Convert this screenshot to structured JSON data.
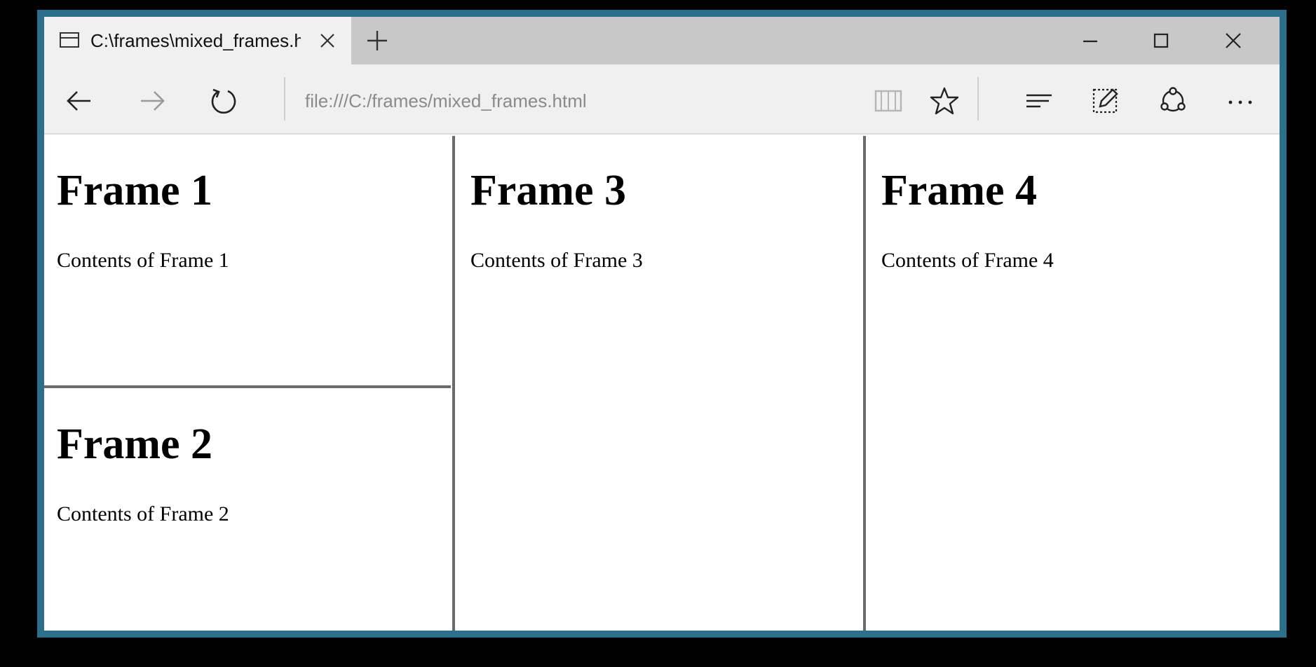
{
  "tab": {
    "title": "C:\\frames\\mixed_frames.html"
  },
  "address_bar": {
    "url": "file:///C:/frames/mixed_frames.html"
  },
  "frames": [
    {
      "heading": "Frame 1",
      "text": "Contents of Frame 1"
    },
    {
      "heading": "Frame 2",
      "text": "Contents of Frame 2"
    },
    {
      "heading": "Frame 3",
      "text": "Contents of Frame 3"
    },
    {
      "heading": "Frame 4",
      "text": "Contents of Frame 4"
    }
  ],
  "icons": {
    "tab": "tab-page-icon",
    "tab_close": "close-icon",
    "new_tab": "plus-icon",
    "minimize": "minimize-icon",
    "maximize": "maximize-icon",
    "close": "close-icon",
    "back": "arrow-left-icon",
    "forward": "arrow-right-icon",
    "refresh": "refresh-icon",
    "reading_view": "book-icon",
    "favorite": "star-icon",
    "hub": "hub-icon",
    "web_note": "pen-note-icon",
    "share": "share-icon",
    "more": "more-icon"
  },
  "colors": {
    "window_border": "#2a6f8b",
    "tabstrip": "#c8c8c8",
    "toolbar": "#f0f0f0",
    "address_text": "#8a8a8a",
    "frame_divider": "#6b6b6b"
  }
}
